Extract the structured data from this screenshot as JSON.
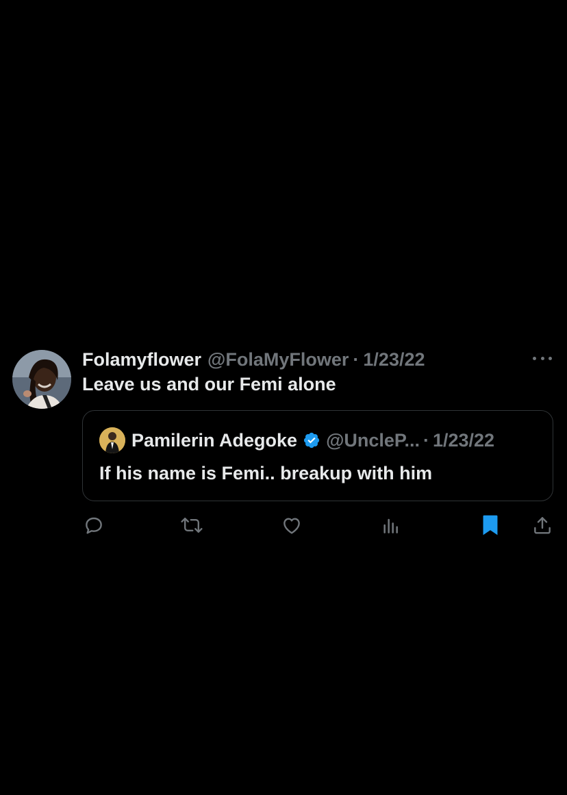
{
  "tweet": {
    "display_name": "Folamyflower",
    "handle": "@FolaMyFlower",
    "separator": "·",
    "date": "1/23/22",
    "text": "Leave us and our Femi alone",
    "more_icon": "more-horizontal-icon"
  },
  "quote": {
    "display_name": "Pamilerin Adegoke",
    "verified_icon": "verified-badge-icon",
    "handle": "@UncleP...",
    "separator": "·",
    "date": "1/23/22",
    "text": "If his name is Femi.. breakup with him"
  },
  "actions": [
    {
      "icon": "reply-icon"
    },
    {
      "icon": "retweet-icon"
    },
    {
      "icon": "like-icon"
    },
    {
      "icon": "views-icon"
    },
    {
      "icon": "bookmark-icon",
      "active": true
    },
    {
      "icon": "share-icon"
    }
  ],
  "colors": {
    "background": "#000000",
    "primary_text": "#e7e9ea",
    "secondary_text": "#71767b",
    "border": "#2f3336",
    "accent_blue": "#1d9bf0"
  }
}
